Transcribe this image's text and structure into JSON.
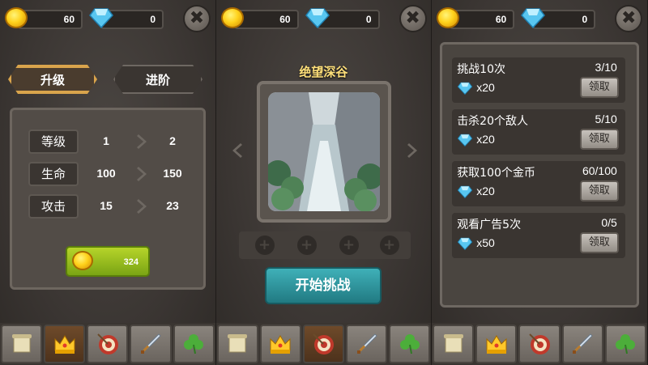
{
  "top_bar": {
    "gold": "60",
    "gems": "0",
    "close": "✖"
  },
  "upgrade_panel": {
    "tabs": [
      "升级",
      "进阶"
    ],
    "stats": [
      {
        "label": "等级",
        "current": "1",
        "next": "2"
      },
      {
        "label": "生命",
        "current": "100",
        "next": "150"
      },
      {
        "label": "攻击",
        "current": "15",
        "next": "23"
      }
    ],
    "upgrade_cost": "324"
  },
  "stage_panel": {
    "title": "绝望深谷",
    "slot_symbol": "+",
    "start_label": "开始挑战"
  },
  "quest_panel": {
    "quests": [
      {
        "title": "挑战10次",
        "progress": "3/10",
        "reward": "x20",
        "button": "领取"
      },
      {
        "title": "击杀20个敌人",
        "progress": "5/10",
        "reward": "x20",
        "button": "领取"
      },
      {
        "title": "获取100个金币",
        "progress": "60/100",
        "reward": "x20",
        "button": "领取"
      },
      {
        "title": "观看广告5次",
        "progress": "0/5",
        "reward": "x50",
        "button": "领取"
      }
    ]
  },
  "bottom_nav": {
    "icons": [
      "scroll-icon",
      "crown-icon",
      "target-icon",
      "sword-icon",
      "clover-icon"
    ]
  },
  "colors": {
    "gold": "#ffd21c",
    "gem": "#58c6f0",
    "accent_tab": "#d9a44c",
    "start_btn": "#2f98a0",
    "upgrade_btn": "#9dc21f"
  }
}
